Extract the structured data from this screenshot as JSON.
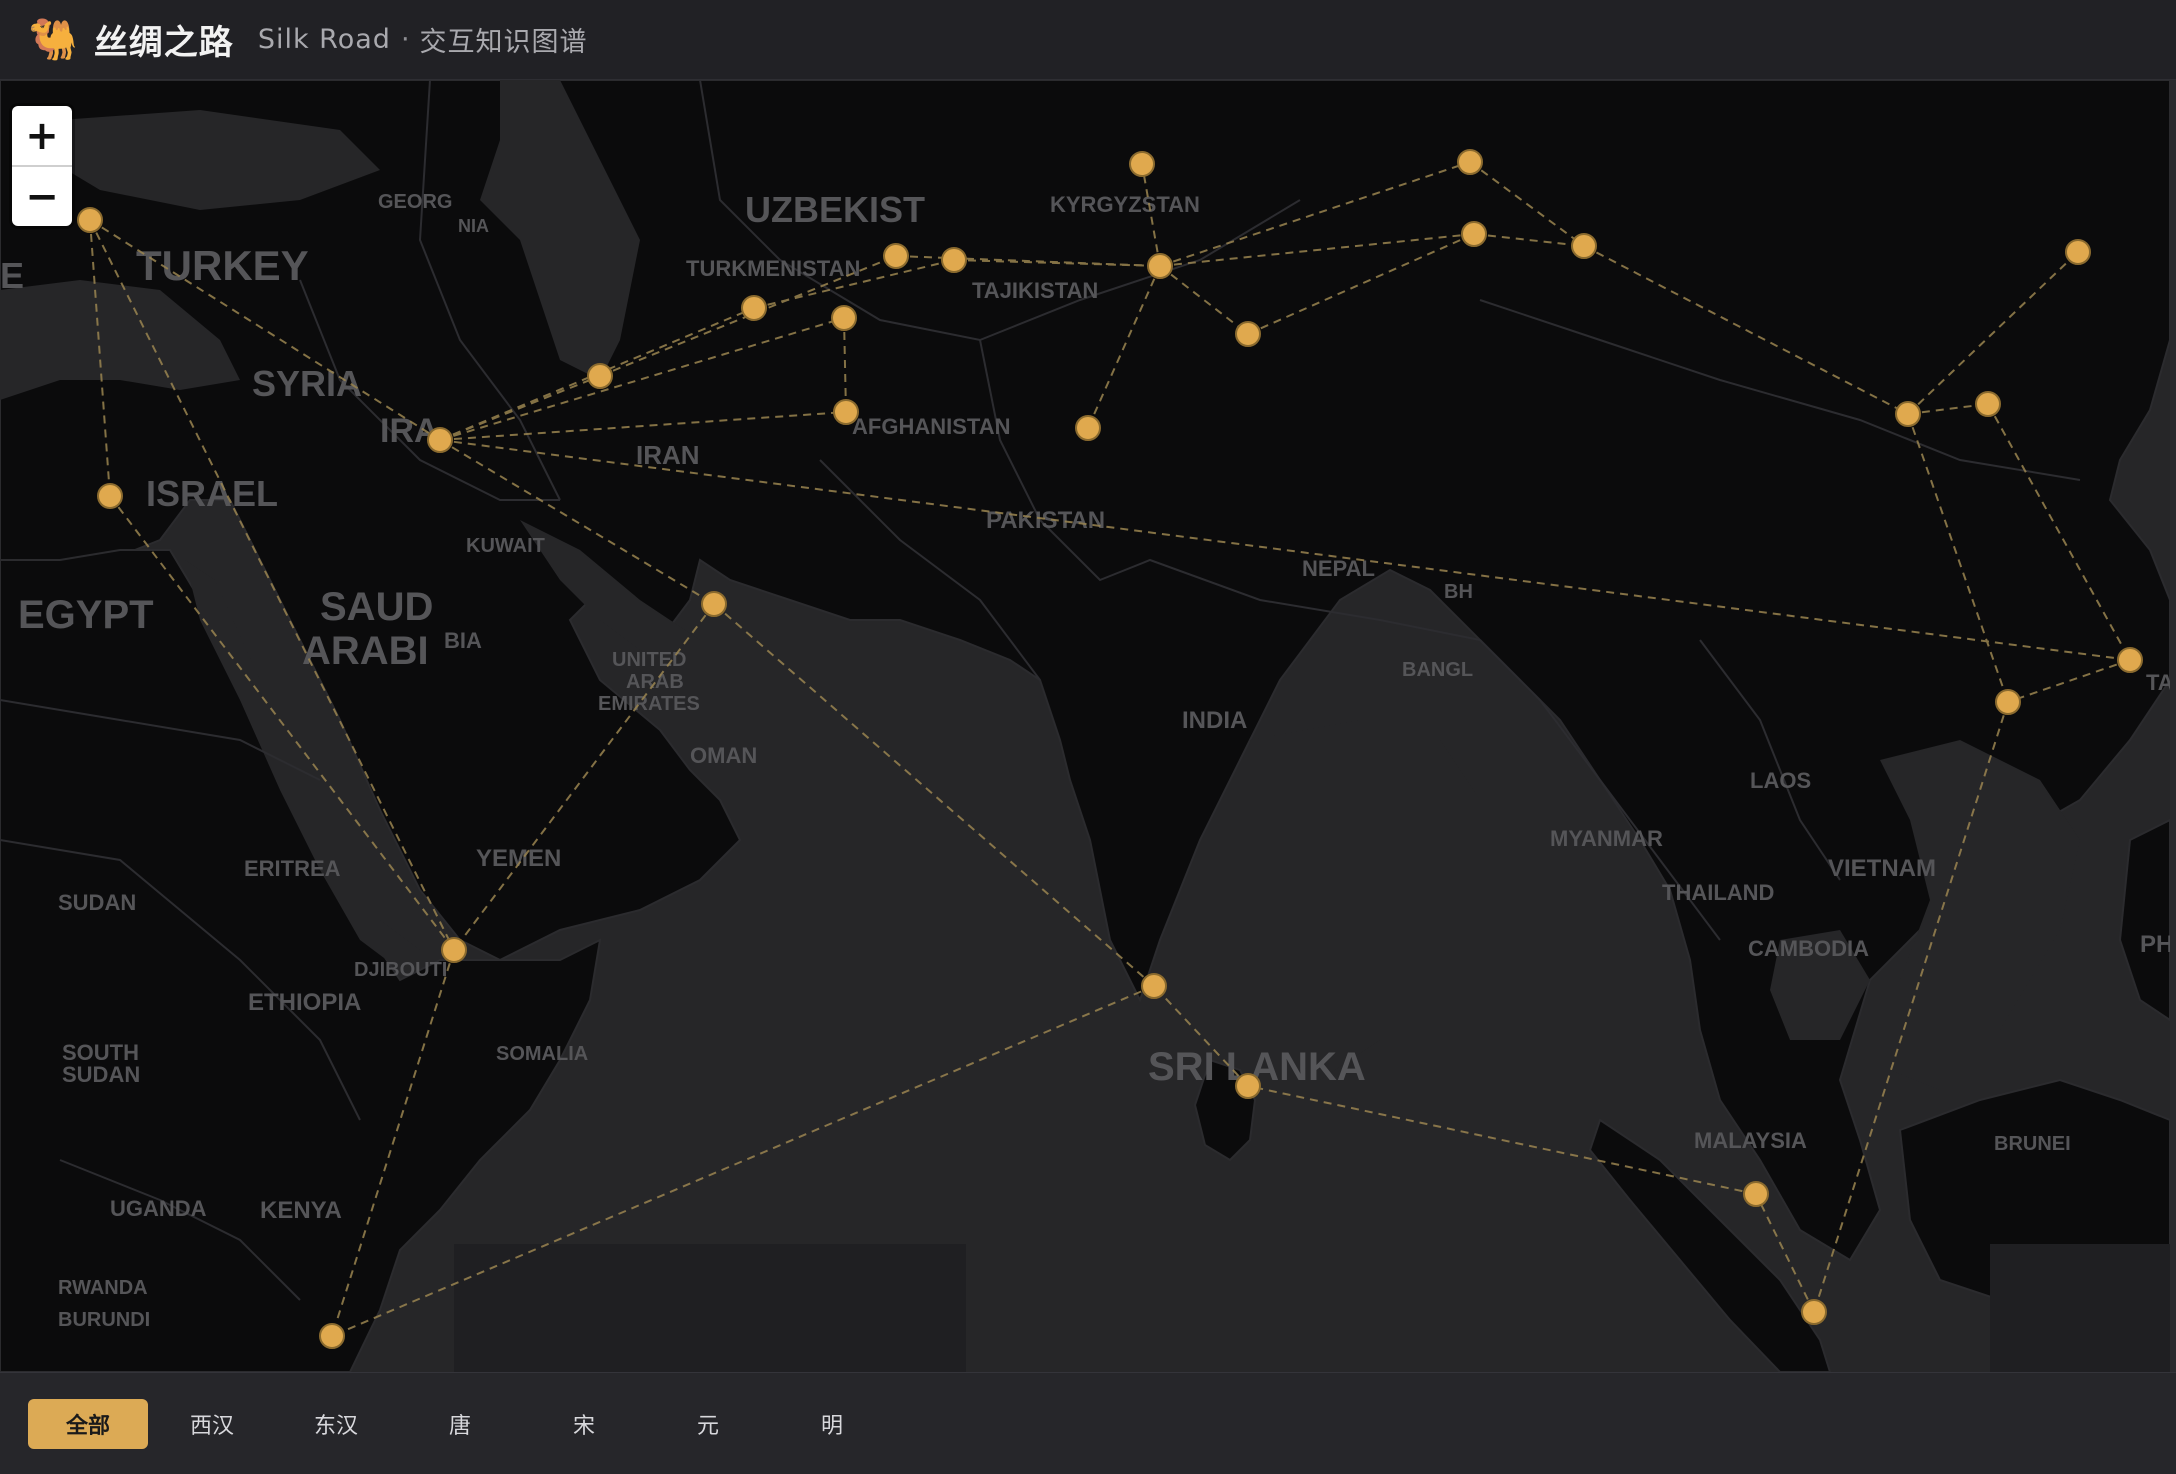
{
  "header": {
    "logo_icon": "camel-icon",
    "logo_glyph": "🐫",
    "title": "丝绸之路",
    "subtitle_en": "Silk Road",
    "separator": "·",
    "subtitle_cn": "交互知识图谱"
  },
  "zoom": {
    "zoom_in": "+",
    "zoom_out": "−"
  },
  "map": {
    "node_color": "#e0a94e",
    "route_color": "#9a8450",
    "country_labels": [
      "UZBEKIST",
      "KYRGYZSTAN",
      "GEORG",
      "NIA",
      "TURKEY",
      "TURKMENISTAN",
      "TAJIKISTAN",
      "SYRIA",
      "IRA",
      "IRAN",
      "AFGHANISTAN",
      "ISRAEL",
      "PAKISTAN",
      "KUWAIT",
      "NEPAL",
      "BH",
      "EGYPT",
      "SAUD",
      "ARABI",
      "BIA",
      "UNITED",
      "ARAB",
      "EMIRATES",
      "BANGL",
      "INDIA",
      "OMAN",
      "LAOS",
      "MYANMAR",
      "VIETNAM",
      "THAILAND",
      "ERITREA",
      "YEMEN",
      "SUDAN",
      "CAMBODIA",
      "PH",
      "DJIBOUTI",
      "ETHIOPIA",
      "SOUTH",
      "SUDAN",
      "SOMALIA",
      "SRI LANKA",
      "MALAYSIA",
      "BRUNEI",
      "UGANDA",
      "KENYA",
      "RWANDA",
      "BURUNDI",
      "TA",
      "E"
    ]
  },
  "periods": [
    {
      "label": "全部",
      "active": true
    },
    {
      "label": "西汉",
      "active": false
    },
    {
      "label": "东汉",
      "active": false
    },
    {
      "label": "唐",
      "active": false
    },
    {
      "label": "宋",
      "active": false
    },
    {
      "label": "元",
      "active": false
    },
    {
      "label": "明",
      "active": false
    }
  ]
}
